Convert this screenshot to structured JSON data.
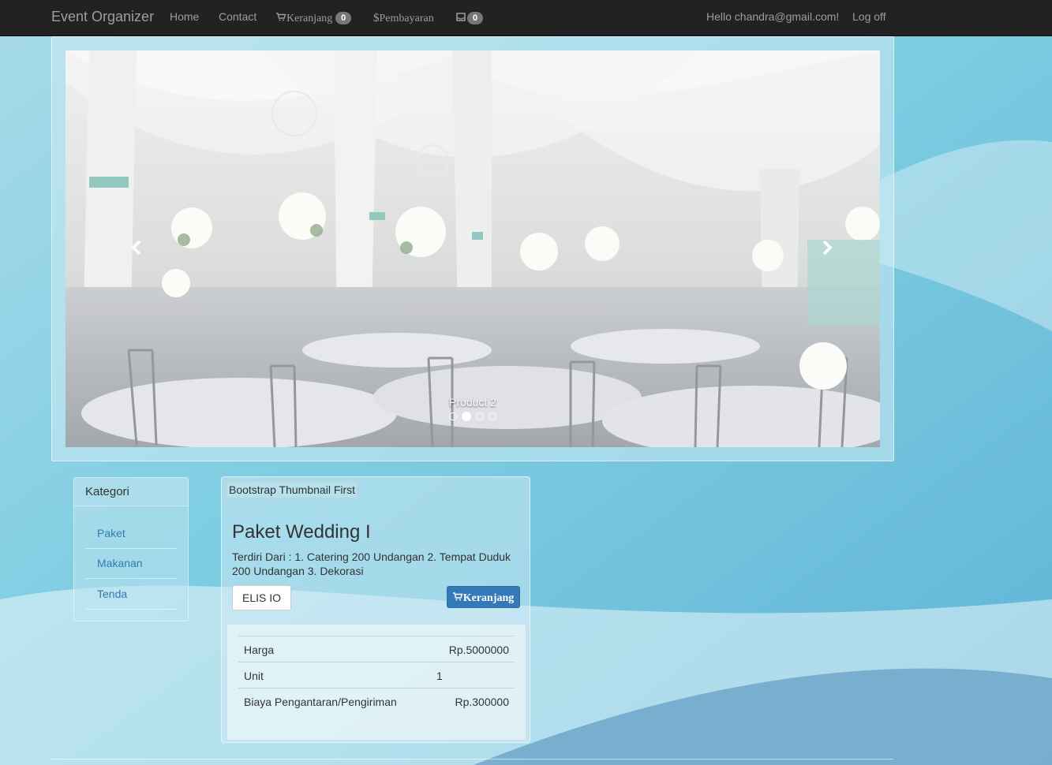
{
  "navbar": {
    "brand": "Event Organizer",
    "home": "Home",
    "contact": "Contact",
    "cart_label": "Keranjang",
    "cart_count": "0",
    "payment_label": "Pembayaran",
    "payment_symbol": "$",
    "inbox_count": "0",
    "greeting": "Hello chandra@gmail.com!",
    "logoff": "Log off"
  },
  "carousel": {
    "caption": "Product 2",
    "slide_count": 4,
    "active_index": 1
  },
  "kategori": {
    "title": "Kategori",
    "items": [
      "Paket",
      "Makanan",
      "Tenda"
    ]
  },
  "product": {
    "image_alt": "Bootstrap Thumbnail First",
    "title": "Paket Wedding I",
    "description": "Terdiri Dari : 1. Catering 200 Undangan 2. Tempat Duduk 200 Undangan 3. Dekorasi",
    "vendor_button": "ELIS IO",
    "cart_button": "Keranjang",
    "details": [
      {
        "label": "Harga",
        "value": "Rp.5000000",
        "mid": ""
      },
      {
        "label": "Unit",
        "value": "",
        "mid": "1"
      },
      {
        "label": "Biaya Pengantaran/Pengiriman",
        "value": "Rp.300000",
        "mid": ""
      }
    ]
  },
  "colors": {
    "navbar_bg": "#222222",
    "link_blue": "#337ab7",
    "button_primary": "#337ab7",
    "badge_bg": "#777777"
  }
}
